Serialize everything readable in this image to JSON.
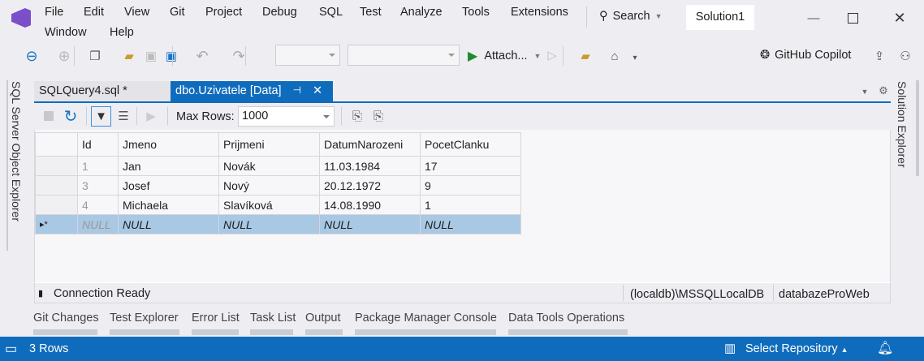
{
  "menu": {
    "row1": [
      "File",
      "Edit",
      "View",
      "Git",
      "Project",
      "Debug",
      "SQL",
      "Test",
      "Analyze",
      "Tools",
      "Extensions"
    ],
    "row2": [
      "Window",
      "Help"
    ]
  },
  "search": {
    "label": "Search"
  },
  "solution_name": "Solution1",
  "toolbar": {
    "attach_label": "Attach...",
    "copilot_label": "GitHub Copilot"
  },
  "side_left": "SQL Server Object Explorer",
  "side_right": "Solution Explorer",
  "tabs": [
    {
      "label": "SQLQuery4.sql *"
    },
    {
      "label": "dbo.Uzivatele [Data]",
      "active": true
    }
  ],
  "grid_toolbar": {
    "max_rows_label": "Max Rows:",
    "max_rows_value": "1000"
  },
  "grid": {
    "columns": [
      "Id",
      "Jmeno",
      "Prijmeni",
      "DatumNarozeni",
      "PocetClanku"
    ],
    "rows": [
      [
        "1",
        "Jan",
        "Novák",
        "11.03.1984",
        "17"
      ],
      [
        "3",
        "Josef",
        "Nový",
        "20.12.1972",
        "9"
      ],
      [
        "4",
        "Michaela",
        "Slavíková",
        "14.08.1990",
        "1"
      ]
    ],
    "new_row": [
      "NULL",
      "NULL",
      "NULL",
      "NULL",
      "NULL"
    ],
    "new_row_marker": "▸*"
  },
  "grid_status": {
    "connection": "Connection Ready",
    "server": "(localdb)\\MSSQLLocalDB",
    "database": "databazeProWeb"
  },
  "bottom_tabs": [
    "Git Changes",
    "Test Explorer",
    "Error List",
    "Task List",
    "Output",
    "Package Manager Console",
    "Data Tools Operations"
  ],
  "status_bar": {
    "rows": "3 Rows",
    "repo": "Select Repository"
  },
  "colors": {
    "accent": "#0f6cbd",
    "selection": "#a8c8e4",
    "logo": "#7b4fc9"
  }
}
